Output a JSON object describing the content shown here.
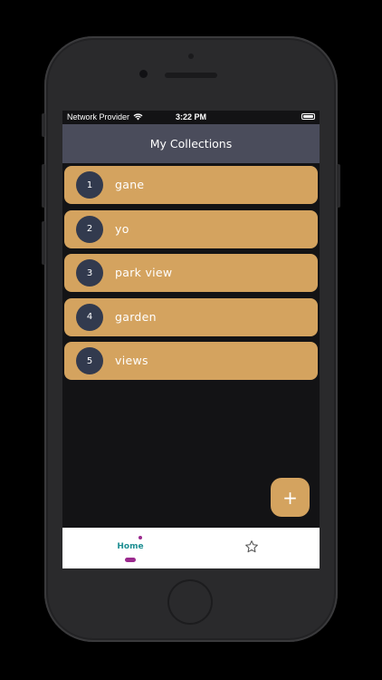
{
  "status_bar": {
    "carrier": "Network Provider",
    "time": "3:22 PM"
  },
  "header": {
    "title": "My Collections"
  },
  "collections": [
    {
      "index": "1",
      "name": "gane"
    },
    {
      "index": "2",
      "name": "yo"
    },
    {
      "index": "3",
      "name": "park view"
    },
    {
      "index": "4",
      "name": "garden"
    },
    {
      "index": "5",
      "name": "views"
    }
  ],
  "fab": {
    "label": "+"
  },
  "tab_bar": {
    "home_label": "Home",
    "favorites_icon": "star-icon"
  },
  "colors": {
    "card": "#d4a35f",
    "badge": "#323a4e",
    "header": "#4a4c5b",
    "screen_bg": "#131315",
    "tab_active": "#1f8f93",
    "tab_indicator": "#9b2a8e"
  }
}
